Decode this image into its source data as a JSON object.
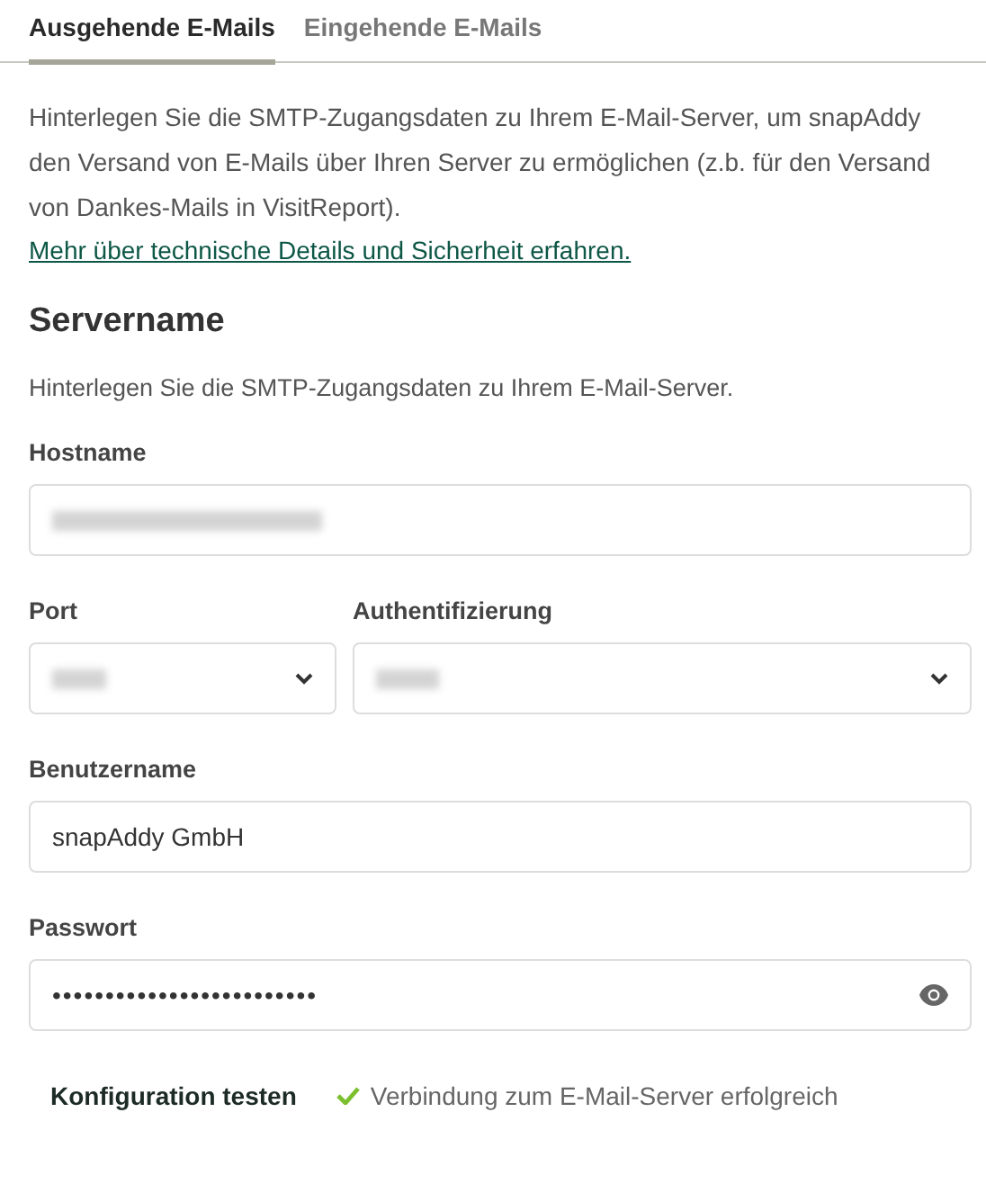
{
  "tabs": [
    {
      "label": "Ausgehende E-Mails",
      "selected": true
    },
    {
      "label": "Eingehende E-Mails",
      "selected": false
    }
  ],
  "intro": {
    "text": "Hinterlegen Sie die SMTP-Zugangsdaten zu Ihrem E-Mail-Server, um snapAddy den Versand von E-Mails über Ihren Server zu ermöglichen (z.b. für den Versand von Dankes-Mails in VisitReport).",
    "link": "Mehr über technische Details und Sicherheit erfahren."
  },
  "section": {
    "title": "Servername",
    "description": "Hinterlegen Sie die SMTP-Zugangsdaten zu Ihrem E-Mail-Server."
  },
  "hostname": {
    "label": "Hostname",
    "kind": "text",
    "redacted": true
  },
  "port": {
    "label": "Port",
    "kind": "select",
    "redacted": true
  },
  "authentication": {
    "label": "Authentifizierung",
    "kind": "select",
    "redacted": true
  },
  "username": {
    "label": "Benutzername",
    "kind": "text",
    "value": "snapAddy GmbH"
  },
  "password": {
    "label": "Passwort",
    "kind": "password",
    "value": "•••••••••••••••••••••••••"
  },
  "test": {
    "button": "Konfiguration testen",
    "success": true,
    "message": "Verbindung zum E-Mail-Server erfolgreich"
  }
}
